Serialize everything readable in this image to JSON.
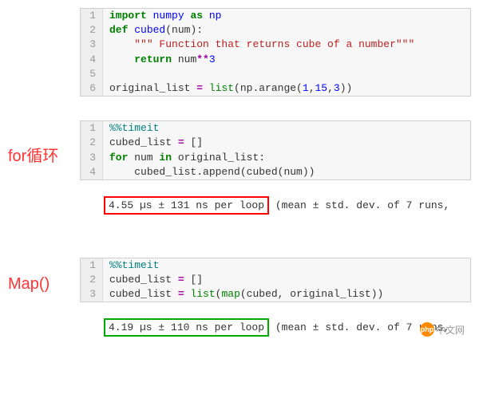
{
  "block1": {
    "lines": [
      "1",
      "2",
      "3",
      "4",
      "5",
      "6"
    ],
    "t": {
      "import": "import",
      "numpy": "numpy",
      "as": "as",
      "np": "np",
      "def": "def",
      "cubed": "cubed",
      "num_param": "(num):",
      "docstring": "\"\"\" Function that returns cube of a number\"\"\"",
      "return": "return",
      "num_var": "num",
      "pow": "**",
      "three": "3",
      "orig": "original_list ",
      "eq": "=",
      "list": " list",
      "np_call": "(np",
      "arange": ".arange(",
      "a1": "1",
      "c1": ",",
      "a2": "15",
      "c2": ",",
      "a3": "3",
      "close": "))"
    }
  },
  "for_label": "for循环",
  "block2": {
    "lines": [
      "1",
      "2",
      "3",
      "4"
    ],
    "t": {
      "timeit": "%%timeit",
      "cubed_list": "cubed_list ",
      "eq": "=",
      "empty": " []",
      "for": "for",
      "num": " num ",
      "in": "in",
      "orig": " original_list:",
      "call": "cubed_list.append(cubed(num))"
    }
  },
  "output_for": {
    "highlight": "4.55 µs ± 131 ns per loop",
    "rest": " (mean ± std. dev. of 7 runs,"
  },
  "map_label": "Map()",
  "block3": {
    "lines": [
      "1",
      "2",
      "3"
    ],
    "t": {
      "timeit": "%%timeit",
      "cubed_list": "cubed_list ",
      "eq": "=",
      "empty": " []",
      "cubed_list2": "cubed_list ",
      "list": " list",
      "map": "map",
      "args": "(cubed, original_list))",
      "lp": "("
    }
  },
  "output_map": {
    "highlight": "4.19 µs ± 110 ns per loop",
    "rest": " (mean ± std. dev. of 7 runs,"
  },
  "watermark": {
    "ball": "php",
    "text": "中文网"
  }
}
